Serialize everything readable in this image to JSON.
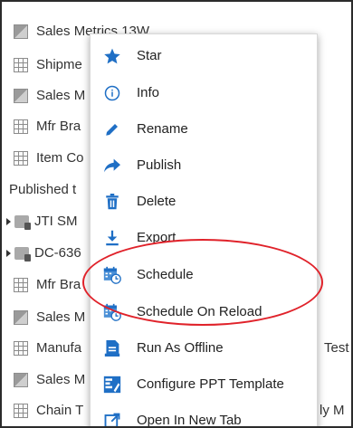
{
  "list": {
    "items": [
      {
        "label": "Sales Metrics 13W",
        "icon": "grey-sheet-icon"
      },
      {
        "label": "Shipme",
        "icon": "grid-icon"
      },
      {
        "label": "Sales M",
        "icon": "grey-sheet-icon"
      },
      {
        "label": "Mfr Bra",
        "icon": "grid-icon"
      },
      {
        "label": "Item Co",
        "icon": "grid-icon"
      }
    ],
    "section_label": "Published t",
    "folders": [
      {
        "label": "JTI SM",
        "icon": "locked-folder-icon"
      },
      {
        "label": "DC-636",
        "icon": "locked-folder-icon"
      }
    ],
    "items2": [
      {
        "label": "Mfr Bra",
        "icon": "grid-icon"
      },
      {
        "label": "Sales M",
        "icon": "grey-sheet-icon"
      },
      {
        "label": "Manufa",
        "icon": "grid-icon"
      },
      {
        "label": "Sales M",
        "icon": "grey-sheet-icon"
      },
      {
        "label": "Chain T",
        "icon": "grid-icon"
      }
    ],
    "right_texts": {
      "test": "Test",
      "ly_m": "ly M"
    }
  },
  "menu": {
    "items": [
      {
        "label": "Star",
        "icon": "star-icon"
      },
      {
        "label": "Info",
        "icon": "info-icon"
      },
      {
        "label": "Rename",
        "icon": "pencil-icon"
      },
      {
        "label": "Publish",
        "icon": "share-arrow-icon"
      },
      {
        "label": "Delete",
        "icon": "trash-icon"
      },
      {
        "label": "Export",
        "icon": "download-icon"
      },
      {
        "label": "Schedule",
        "icon": "calendar-clock-icon"
      },
      {
        "label": "Schedule On Reload",
        "icon": "calendar-clock-icon"
      },
      {
        "label": "Run As Offline",
        "icon": "offline-report-icon"
      },
      {
        "label": "Configure PPT Template",
        "icon": "ppt-template-icon"
      },
      {
        "label": "Open In New Tab",
        "icon": "open-new-tab-icon"
      }
    ]
  },
  "colors": {
    "icon_blue": "#1f6fc5",
    "highlight_red": "#e0222a"
  }
}
